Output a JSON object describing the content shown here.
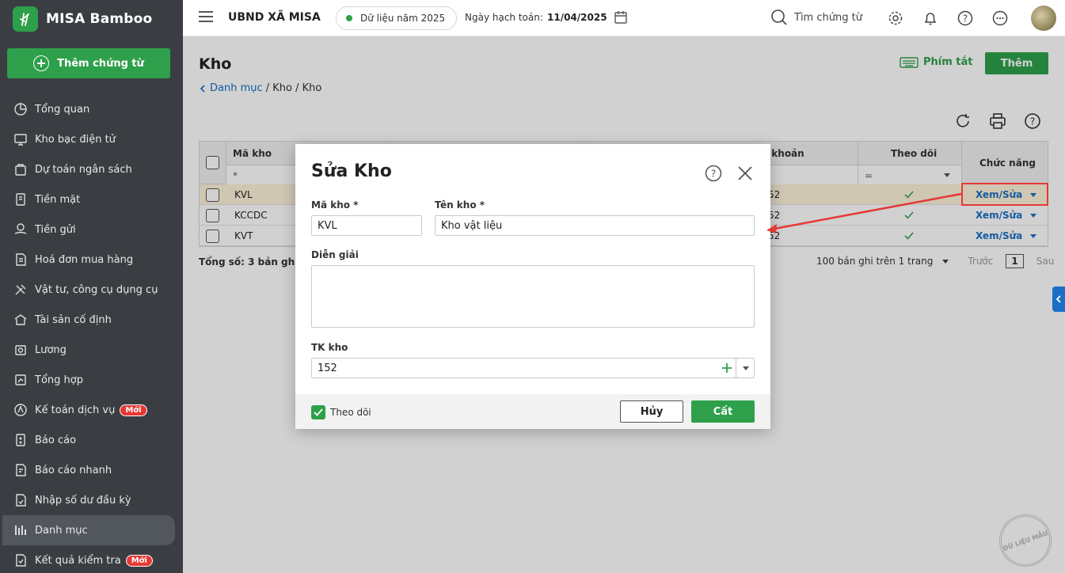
{
  "brand": {
    "name": "MISA Bamboo"
  },
  "sidebar": {
    "add_label": "Thêm chứng từ",
    "items": [
      {
        "label": "Tổng quan",
        "icon": "pie-chart-icon"
      },
      {
        "label": "Kho bạc điện tử",
        "icon": "monitor-icon"
      },
      {
        "label": "Dự toán ngân sách",
        "icon": "budget-icon"
      },
      {
        "label": "Tiền mặt",
        "icon": "cash-icon"
      },
      {
        "label": "Tiền gửi",
        "icon": "deposit-icon"
      },
      {
        "label": "Hoá đơn mua hàng",
        "icon": "invoice-icon"
      },
      {
        "label": "Vật tư, công cụ dụng cụ",
        "icon": "tools-icon"
      },
      {
        "label": "Tài sản cố định",
        "icon": "asset-icon"
      },
      {
        "label": "Lương",
        "icon": "salary-icon"
      },
      {
        "label": "Tổng hợp",
        "icon": "summary-icon"
      },
      {
        "label": "Kế toán dịch vụ",
        "icon": "service-icon",
        "badge": "Mới"
      },
      {
        "label": "Báo cáo",
        "icon": "report-icon"
      },
      {
        "label": "Báo cáo nhanh",
        "icon": "quick-report-icon"
      },
      {
        "label": "Nhập số dư đầu kỳ",
        "icon": "opening-balance-icon"
      },
      {
        "label": "Danh mục",
        "icon": "catalog-icon",
        "active": true
      },
      {
        "label": "Kết quả kiểm tra",
        "icon": "check-result-icon",
        "badge": "Mới"
      }
    ]
  },
  "topbar": {
    "org": "UBND XÃ MISA",
    "year": "Dữ liệu năm 2025",
    "date_label": "Ngày hạch toán:",
    "date_value": "11/04/2025",
    "search": "Tìm chứng từ"
  },
  "page": {
    "title": "Kho",
    "shortcut": "Phím tắt",
    "add": "Thêm",
    "breadcrumb": {
      "link": "Danh mục",
      "rest": " / Kho / Kho"
    }
  },
  "grid": {
    "headers": {
      "code": "Mã kho",
      "account": "i khoản",
      "track": "Theo dõi",
      "action": "Chức năng"
    },
    "filter_code": "*",
    "filter_track": "=",
    "rows": [
      {
        "code": "KVL",
        "account": "52",
        "action": "Xem/Sửa"
      },
      {
        "code": "KCCDC",
        "account": "52",
        "action": "Xem/Sửa"
      },
      {
        "code": "KVT",
        "account": "52",
        "action": "Xem/Sửa"
      }
    ],
    "total": "Tổng số: 3 bản ghi",
    "page_size": "100 bản ghi trên 1 trang",
    "prev": "Trước",
    "page": "1",
    "next": "Sau"
  },
  "modal": {
    "title": "Sửa Kho",
    "code_label": "Mã kho *",
    "code_value": "KVL",
    "name_label": "Tên kho *",
    "name_value": "Kho vật liệu",
    "desc_label": "Diễn giải",
    "account_label": "TK kho",
    "account_value": "152",
    "track_label": "Theo dõi",
    "cancel": "Hủy",
    "save": "Cất"
  },
  "watermark": "DỮ LIỆU MẪU",
  "colors": {
    "accent": "#2ea04b",
    "link": "#1a6fc4",
    "highlight": "#e53935",
    "sidebar": "#3a3e43"
  }
}
